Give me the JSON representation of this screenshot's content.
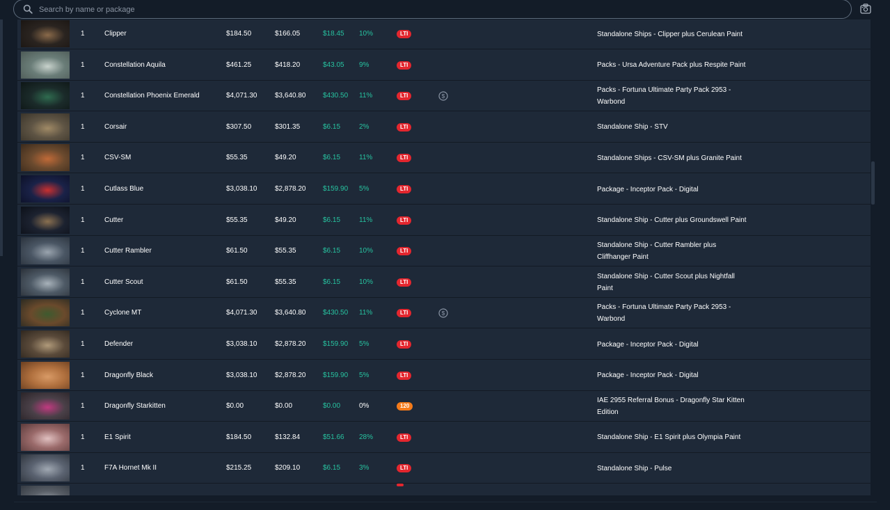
{
  "search": {
    "placeholder": "Search by name or package",
    "value": ""
  },
  "colors": {
    "accent_green": "#27c3a0",
    "lti_badge": "#e3262e",
    "referral_badge": "#f57b1a",
    "row_bg": "#1e2938"
  },
  "icons": {
    "search": "search-icon",
    "camera": "camera-icon",
    "coin": "dollar-coin-icon"
  },
  "rows": [
    {
      "qty": "1",
      "name": "Clipper",
      "price1": "$184.50",
      "price2": "$166.05",
      "diff": "$18.45",
      "pct": "10%",
      "badge": "LTI",
      "coin": false,
      "package": "Standalone Ships - Clipper plus Cerulean Paint",
      "thumb": [
        "#2a2420",
        "#8a6a4a",
        "#1a1512"
      ]
    },
    {
      "qty": "1",
      "name": "Constellation Aquila",
      "price1": "$461.25",
      "price2": "$418.20",
      "diff": "$43.05",
      "pct": "9%",
      "badge": "LTI",
      "coin": false,
      "package": "Packs - Ursa Adventure Pack plus Respite Paint",
      "thumb": [
        "#6a7d78",
        "#c8d2cc",
        "#4d5a56"
      ]
    },
    {
      "qty": "1",
      "name": "Constellation Phoenix Emerald",
      "price1": "$4,071.30",
      "price2": "$3,640.80",
      "diff": "$430.50",
      "pct": "11%",
      "badge": "LTI",
      "coin": true,
      "package": "Packs - Fortuna Ultimate Party Pack 2953 - Warbond",
      "thumb": [
        "#1b2b2a",
        "#2f6b4f",
        "#0e1616"
      ]
    },
    {
      "qty": "1",
      "name": "Corsair",
      "price1": "$307.50",
      "price2": "$301.35",
      "diff": "$6.15",
      "pct": "2%",
      "badge": "LTI",
      "coin": false,
      "package": "Standalone Ship - STV",
      "thumb": [
        "#5e5444",
        "#a08a66",
        "#3a342a"
      ]
    },
    {
      "qty": "1",
      "name": "CSV-SM",
      "price1": "$55.35",
      "price2": "$49.20",
      "diff": "$6.15",
      "pct": "11%",
      "badge": "LTI",
      "coin": false,
      "package": "Standalone Ships - CSV-SM plus Granite Paint",
      "thumb": [
        "#6b4a2e",
        "#c06a38",
        "#3a2a1c"
      ]
    },
    {
      "qty": "1",
      "name": "Cutlass Blue",
      "price1": "$3,038.10",
      "price2": "$2,878.20",
      "diff": "$159.90",
      "pct": "5%",
      "badge": "LTI",
      "coin": false,
      "package": "Package - Inceptor Pack - Digital",
      "thumb": [
        "#1a2248",
        "#c83030",
        "#0c1026"
      ]
    },
    {
      "qty": "1",
      "name": "Cutter",
      "price1": "$55.35",
      "price2": "$49.20",
      "diff": "$6.15",
      "pct": "11%",
      "badge": "LTI",
      "coin": false,
      "package": "Standalone Ship - Cutter plus Groundswell Paint",
      "thumb": [
        "#1c2230",
        "#8a7050",
        "#0c1018"
      ]
    },
    {
      "qty": "1",
      "name": "Cutter Rambler",
      "price1": "$61.50",
      "price2": "$55.35",
      "diff": "$6.15",
      "pct": "10%",
      "badge": "LTI",
      "coin": false,
      "package": "Standalone Ship - Cutter Rambler plus Cliffhanger Paint",
      "thumb": [
        "#4a5664",
        "#9aa4ae",
        "#2a323c"
      ]
    },
    {
      "qty": "1",
      "name": "Cutter Scout",
      "price1": "$61.50",
      "price2": "$55.35",
      "diff": "$6.15",
      "pct": "10%",
      "badge": "LTI",
      "coin": false,
      "package": "Standalone Ship - Cutter Scout plus Nightfall Paint",
      "thumb": [
        "#4e5a66",
        "#a8b2ba",
        "#2a3038"
      ]
    },
    {
      "qty": "1",
      "name": "Cyclone MT",
      "price1": "$4,071.30",
      "price2": "$3,640.80",
      "diff": "$430.50",
      "pct": "11%",
      "badge": "LTI",
      "coin": true,
      "package": "Packs - Fortuna Ultimate Party Pack 2953 - Warbond",
      "thumb": [
        "#6a4a2c",
        "#3e5a2e",
        "#2a2a22"
      ]
    },
    {
      "qty": "1",
      "name": "Defender",
      "price1": "$3,038.10",
      "price2": "$2,878.20",
      "diff": "$159.90",
      "pct": "5%",
      "badge": "LTI",
      "coin": false,
      "package": "Package - Inceptor Pack - Digital",
      "thumb": [
        "#5a4a3a",
        "#b09a7a",
        "#2e261e"
      ]
    },
    {
      "qty": "1",
      "name": "Dragonfly Black",
      "price1": "$3,038.10",
      "price2": "$2,878.20",
      "diff": "$159.90",
      "pct": "5%",
      "badge": "LTI",
      "coin": false,
      "package": "Package - Inceptor Pack - Digital",
      "thumb": [
        "#b0703e",
        "#d89a66",
        "#6a3e20"
      ]
    },
    {
      "qty": "1",
      "name": "Dragonfly Starkitten",
      "price1": "$0.00",
      "price2": "$0.00",
      "diff": "$0.00",
      "pct": "0%",
      "badge": "120",
      "coin": false,
      "package": "IAE 2955 Referral Bonus - Dragonfly Star Kitten Edition",
      "thumb": [
        "#4a4048",
        "#c03a80",
        "#2a2428"
      ]
    },
    {
      "qty": "1",
      "name": "E1 Spirit",
      "price1": "$184.50",
      "price2": "$132.84",
      "diff": "$51.66",
      "pct": "28%",
      "badge": "LTI",
      "coin": false,
      "package": "Standalone Ship - E1 Spirit plus Olympia Paint",
      "thumb": [
        "#9a6a6a",
        "#e0c0c0",
        "#5a3a3a"
      ]
    },
    {
      "qty": "1",
      "name": "F7A Hornet Mk II",
      "price1": "$215.25",
      "price2": "$209.10",
      "diff": "$6.15",
      "pct": "3%",
      "badge": "LTI",
      "coin": false,
      "package": "Standalone Ship - Pulse",
      "thumb": [
        "#5a6270",
        "#a0a8b2",
        "#2e343c"
      ]
    },
    {
      "qty": "",
      "name": "",
      "price1": "",
      "price2": "",
      "diff": "",
      "pct": "",
      "badge": "LTI",
      "coin": false,
      "package": "",
      "thumb": [
        "#5a6068",
        "#9aa0a8",
        "#343a42"
      ]
    }
  ]
}
